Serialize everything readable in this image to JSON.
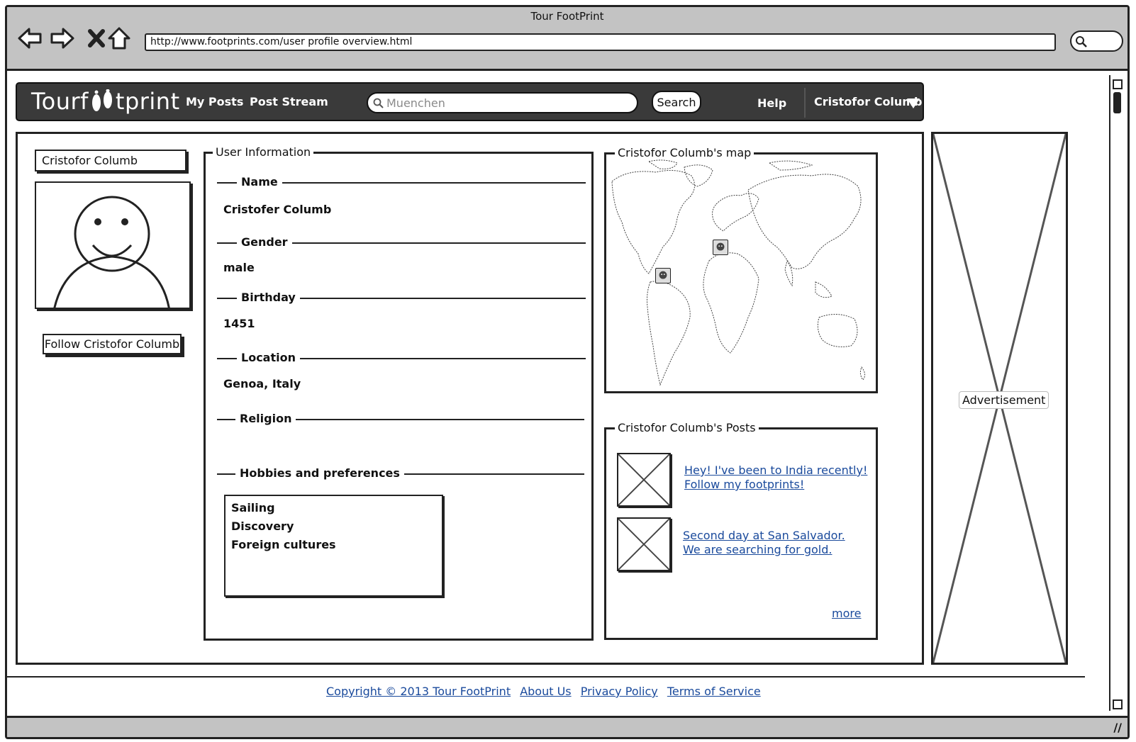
{
  "window": {
    "title": "Tour FootPrint",
    "url": "http://www.footprints.com/user profile overview.html"
  },
  "nav": {
    "logo": "Tourf  tprint",
    "my_posts": "My Posts",
    "post_stream": "Post Stream",
    "search_placeholder": "Muenchen",
    "search_button": "Search",
    "help": "Help",
    "user": "Cristofor Columb"
  },
  "profile": {
    "username": "Cristofor Columb",
    "follow_button": "Follow Cristofor Columb"
  },
  "user_info": {
    "legend": "User Information",
    "name_label": "Name",
    "name_value": "Cristofer Columb",
    "gender_label": "Gender",
    "gender_value": "male",
    "birthday_label": "Birthday",
    "birthday_value": "1451",
    "location_label": "Location",
    "location_value": "Genoa, Italy",
    "religion_label": "Religion",
    "hobbies_label": "Hobbies and preferences",
    "hobbies": [
      "Sailing",
      "Discovery",
      "Foreign cultures"
    ]
  },
  "map": {
    "legend": "Cristofor Columb's map"
  },
  "posts": {
    "legend": "Cristofor Columb's Posts",
    "items": [
      {
        "line1": "Hey! I've been to India recently!",
        "line2": "Follow my footprints!"
      },
      {
        "line1": "Second day at San Salvador.",
        "line2": "We are searching for gold."
      }
    ],
    "more": "more"
  },
  "ad": {
    "label": "Advertisement"
  },
  "footer": {
    "copyright": "Copyright © 2013 Tour FootPrint",
    "about": "About Us",
    "privacy": "Privacy Policy",
    "terms": "Terms of Service"
  },
  "icons": {
    "back": "back-arrow-icon",
    "forward": "forward-arrow-icon",
    "stop": "close-icon",
    "home": "home-icon",
    "search": "search-icon"
  }
}
